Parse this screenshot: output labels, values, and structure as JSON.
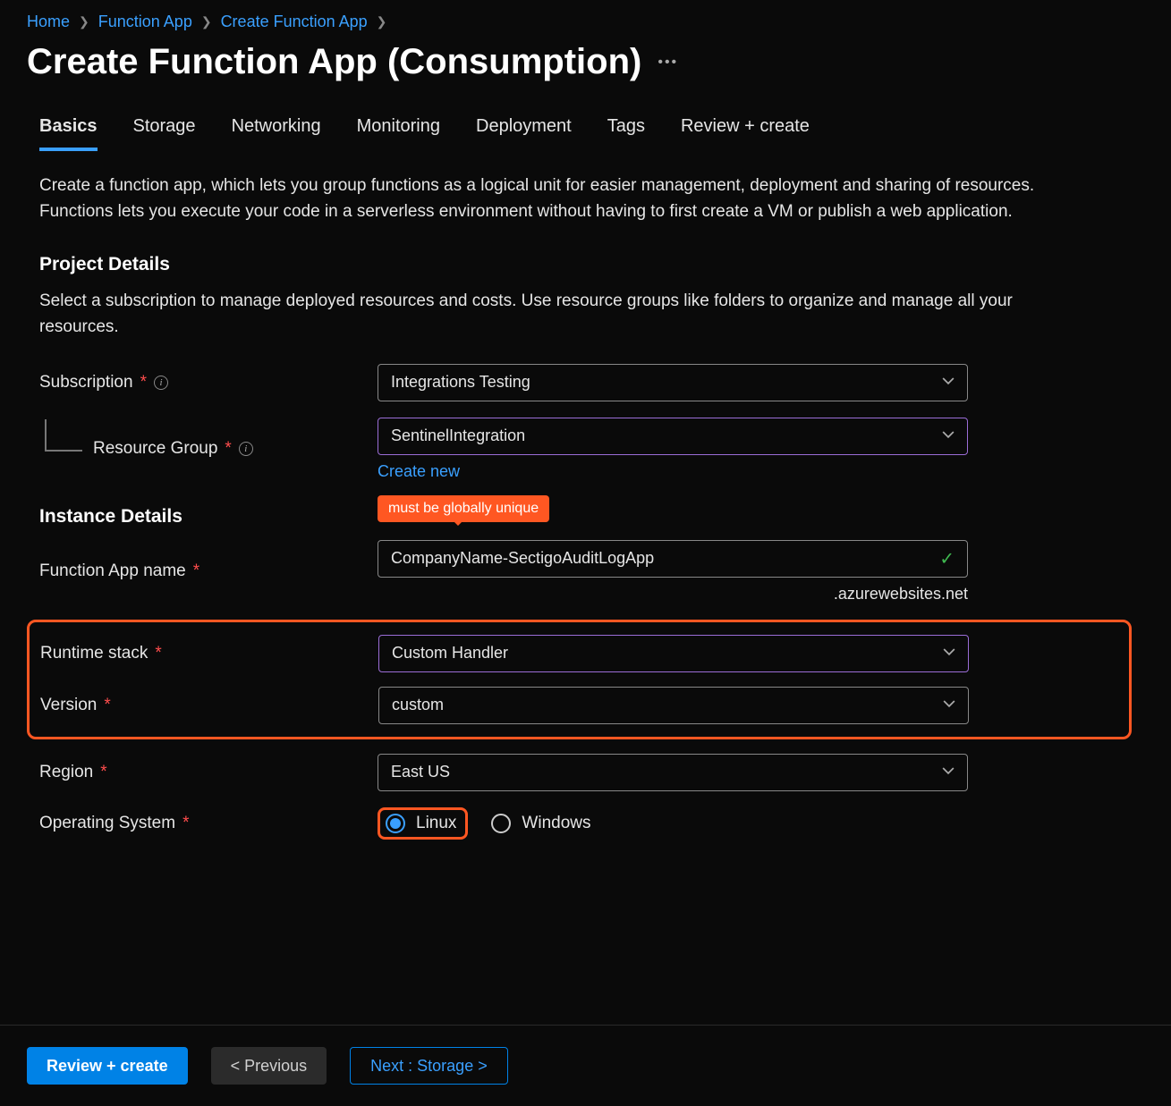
{
  "breadcrumb": {
    "items": [
      "Home",
      "Function App",
      "Create Function App"
    ]
  },
  "page": {
    "title": "Create Function App (Consumption)"
  },
  "tabs": [
    "Basics",
    "Storage",
    "Networking",
    "Monitoring",
    "Deployment",
    "Tags",
    "Review + create"
  ],
  "intro": "Create a function app, which lets you group functions as a logical unit for easier management, deployment and sharing of resources. Functions lets you execute your code in a serverless environment without having to first create a VM or publish a web application.",
  "project": {
    "heading": "Project Details",
    "desc": "Select a subscription to manage deployed resources and costs. Use resource groups like folders to organize and manage all your resources.",
    "subscription_label": "Subscription",
    "subscription_value": "Integrations Testing",
    "rg_label": "Resource Group",
    "rg_value": "SentinelIntegration",
    "create_new": "Create new"
  },
  "instance": {
    "heading": "Instance Details",
    "callout": "must be globally unique",
    "name_label": "Function App name",
    "name_value": "CompanyName-SectigoAuditLogApp",
    "suffix": ".azurewebsites.net",
    "runtime_label": "Runtime stack",
    "runtime_value": "Custom Handler",
    "version_label": "Version",
    "version_value": "custom",
    "region_label": "Region",
    "region_value": "East US",
    "os_label": "Operating System",
    "os_linux": "Linux",
    "os_windows": "Windows"
  },
  "footer": {
    "review": "Review + create",
    "prev": "< Previous",
    "next": "Next : Storage >"
  }
}
